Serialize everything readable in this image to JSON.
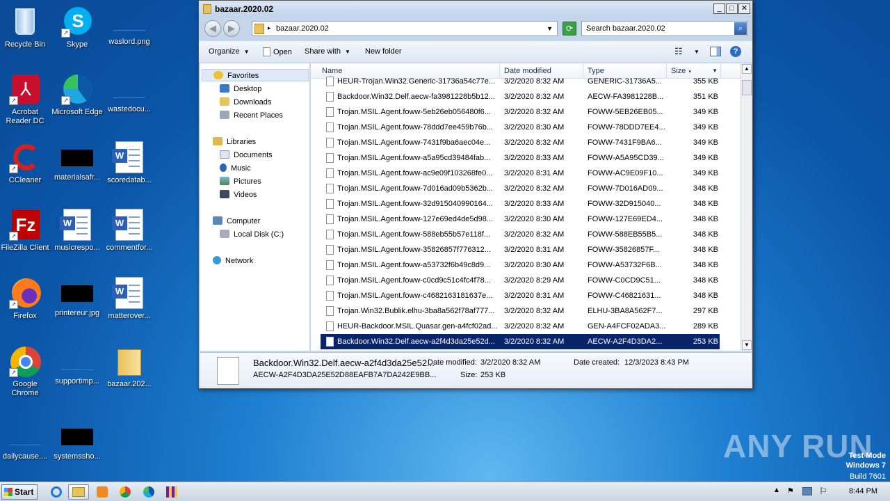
{
  "desktop": {
    "icons": [
      {
        "label": "Recycle Bin"
      },
      {
        "label": "Skype"
      },
      {
        "label": "waslord.png"
      },
      {
        "label": "Acrobat Reader DC"
      },
      {
        "label": "Microsoft Edge"
      },
      {
        "label": "wastedocu..."
      },
      {
        "label": "CCleaner"
      },
      {
        "label": "materialsafr..."
      },
      {
        "label": "scoredatab..."
      },
      {
        "label": "FileZilla Client"
      },
      {
        "label": "musicrespo..."
      },
      {
        "label": "commentfor..."
      },
      {
        "label": "Firefox"
      },
      {
        "label": "printereur.jpg"
      },
      {
        "label": "matterover..."
      },
      {
        "label": "Google Chrome"
      },
      {
        "label": "supportimp..."
      },
      {
        "label": "bazaar.202..."
      },
      {
        "label": "dailycause...."
      },
      {
        "label": "systemssho..."
      }
    ]
  },
  "window": {
    "title": "bazaar.2020.02",
    "address": "bazaar.2020.02",
    "search_placeholder": "Search bazaar.2020.02",
    "toolbar": {
      "organize": "Organize",
      "open": "Open",
      "share_with": "Share with",
      "new_folder": "New folder"
    },
    "nav": {
      "favorites": "Favorites",
      "desktop": "Desktop",
      "downloads": "Downloads",
      "recent_places": "Recent Places",
      "libraries": "Libraries",
      "documents": "Documents",
      "music": "Music",
      "pictures": "Pictures",
      "videos": "Videos",
      "computer": "Computer",
      "local_disk": "Local Disk (C:)",
      "network": "Network"
    },
    "columns": {
      "name": "Name",
      "date_modified": "Date modified",
      "type": "Type",
      "size": "Size"
    },
    "files": [
      {
        "name": "HEUR-Trojan.Win32.Generic-31736a54c77e...",
        "date": "3/2/2020 8:32 AM",
        "type": "GENERIC-31736A5...",
        "size": "355 KB"
      },
      {
        "name": "Backdoor.Win32.Delf.aecw-fa3981228b5b12...",
        "date": "3/2/2020 8:32 AM",
        "type": "AECW-FA3981228B...",
        "size": "351 KB"
      },
      {
        "name": "Trojan.MSIL.Agent.foww-5eb26eb056480f6...",
        "date": "3/2/2020 8:32 AM",
        "type": "FOWW-5EB26EB05...",
        "size": "349 KB"
      },
      {
        "name": "Trojan.MSIL.Agent.foww-78ddd7ee459b76b...",
        "date": "3/2/2020 8:30 AM",
        "type": "FOWW-78DDD7EE4...",
        "size": "349 KB"
      },
      {
        "name": "Trojan.MSIL.Agent.foww-7431f9ba6aec04e...",
        "date": "3/2/2020 8:32 AM",
        "type": "FOWW-7431F9BA6...",
        "size": "349 KB"
      },
      {
        "name": "Trojan.MSIL.Agent.foww-a5a95cd39484fab...",
        "date": "3/2/2020 8:33 AM",
        "type": "FOWW-A5A95CD39...",
        "size": "349 KB"
      },
      {
        "name": "Trojan.MSIL.Agent.foww-ac9e09f103268fe0...",
        "date": "3/2/2020 8:31 AM",
        "type": "FOWW-AC9E09F10...",
        "size": "349 KB"
      },
      {
        "name": "Trojan.MSIL.Agent.foww-7d016ad09b5362b...",
        "date": "3/2/2020 8:32 AM",
        "type": "FOWW-7D016AD09...",
        "size": "348 KB"
      },
      {
        "name": "Trojan.MSIL.Agent.foww-32d915040990164...",
        "date": "3/2/2020 8:33 AM",
        "type": "FOWW-32D915040...",
        "size": "348 KB"
      },
      {
        "name": "Trojan.MSIL.Agent.foww-127e69ed4de5d98...",
        "date": "3/2/2020 8:30 AM",
        "type": "FOWW-127E69ED4...",
        "size": "348 KB"
      },
      {
        "name": "Trojan.MSIL.Agent.foww-588eb55b57e118f...",
        "date": "3/2/2020 8:32 AM",
        "type": "FOWW-588EB55B5...",
        "size": "348 KB"
      },
      {
        "name": "Trojan.MSIL.Agent.foww-35826857f776312...",
        "date": "3/2/2020 8:31 AM",
        "type": "FOWW-35826857F...",
        "size": "348 KB"
      },
      {
        "name": "Trojan.MSIL.Agent.foww-a53732f6b49c8d9...",
        "date": "3/2/2020 8:30 AM",
        "type": "FOWW-A53732F6B...",
        "size": "348 KB"
      },
      {
        "name": "Trojan.MSIL.Agent.foww-c0cd9c51c4fc4f78...",
        "date": "3/2/2020 8:29 AM",
        "type": "FOWW-C0CD9C51...",
        "size": "348 KB"
      },
      {
        "name": "Trojan.MSIL.Agent.foww-c4682163181637e...",
        "date": "3/2/2020 8:31 AM",
        "type": "FOWW-C46821631...",
        "size": "348 KB"
      },
      {
        "name": "Trojan.Win32.Bublik.elhu-3ba8a562f78af777...",
        "date": "3/2/2020 8:32 AM",
        "type": "ELHU-3BA8A562F7...",
        "size": "297 KB"
      },
      {
        "name": "HEUR-Backdoor.MSIL.Quasar.gen-a4fcf02ad...",
        "date": "3/2/2020 8:32 AM",
        "type": "GEN-A4FCF02ADA3...",
        "size": "289 KB"
      },
      {
        "name": "Backdoor.Win32.Delf.aecw-a2f4d3da25e52d...",
        "date": "3/2/2020 8:32 AM",
        "type": "AECW-A2F4D3DA2...",
        "size": "253 KB",
        "selected": true
      }
    ],
    "details": {
      "name": "Backdoor.Win32.Delf.aecw-a2f4d3da25e52...",
      "type": "AECW-A2F4D3DA25E52D88EAFB7A7DA242E9BB...",
      "date_modified_label": "Date modified:",
      "date_modified": "3/2/2020 8:32 AM",
      "size_label": "Size:",
      "size": "253 KB",
      "date_created_label": "Date created:",
      "date_created": "12/3/2023 8:43 PM"
    }
  },
  "taskbar": {
    "start": "Start",
    "clock": "8:44 PM"
  },
  "watermark": {
    "brand": "ANY RUN",
    "line1": "Test Mode",
    "line2": "Windows 7",
    "line3": "Build 7601"
  }
}
